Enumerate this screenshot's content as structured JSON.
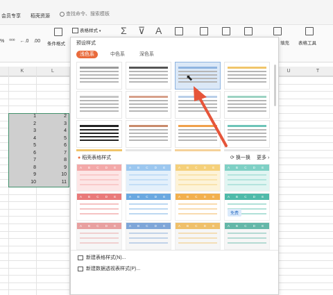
{
  "menubar": {
    "items": [
      "会员专享",
      "稻壳资源"
    ],
    "search_placeholder": "查找命令、搜索模板"
  },
  "ribbon": {
    "table_style_label": "表格样式",
    "conditional_format_label": "条件格式",
    "fill_label": "填充",
    "table_tools_label": "表格工具",
    "format_symbols": [
      "%",
      "⁰⁰⁰",
      "←.0",
      ".00"
    ]
  },
  "sheet": {
    "columns": [
      "K",
      "L",
      "U",
      "T"
    ],
    "col_k_values": [
      "1",
      "2",
      "3",
      "4",
      "5",
      "6",
      "7",
      "8",
      "9",
      "10"
    ],
    "col_l_values": [
      "2",
      "3",
      "4",
      "5",
      "6",
      "7",
      "8",
      "9",
      "10",
      "11"
    ]
  },
  "popup": {
    "preset_label": "预设样式",
    "tabs": [
      "浅色系",
      "中色系",
      "深色系"
    ],
    "docer_label": "稻壳表格样式",
    "refresh_label": "换一换",
    "more_label": "更多",
    "template_header": "A B C D E",
    "free_badge": "免费",
    "new_style_label": "新建表格样式(N)...",
    "new_pivot_label": "新建数据透视表样式(P)..."
  },
  "colors": {
    "accent": "#e96b3c",
    "arrow": "#e6553a",
    "selection_fill": "#cfcfcf",
    "selection_border": "#3f8f6a"
  },
  "thumbs_row1": [
    "#9a9a9a",
    "#555555",
    "#8fb4e0",
    "#f0c56a"
  ],
  "thumbs_row2": [
    "#c5c5c5",
    "#d6a08a",
    "#b9cfe8",
    "#9bd2c2"
  ],
  "thumbs_row3": [
    "#222222",
    "#c98a6a",
    "#f0a04a",
    "#6cc4b8"
  ],
  "templates": [
    {
      "head": "#f3a9a9",
      "body": "#fde6e6"
    },
    {
      "head": "#9cc7ef",
      "body": "#e4f0fb"
    },
    {
      "head": "#f5d07a",
      "body": "#fdf3d8"
    },
    {
      "head": "#7fd0c5",
      "body": "#e1f5f2"
    },
    {
      "head": "#e97a7a",
      "body": "#ffffff"
    },
    {
      "head": "#6aa8e0",
      "body": "#ffffff"
    },
    {
      "head": "#f2b04e",
      "body": "#ffffff"
    },
    {
      "head": "#4fbaa9",
      "body": "#ffffff"
    },
    {
      "head": "#e8a0a0",
      "body": "#f6f6f6"
    },
    {
      "head": "#7fa6d8",
      "body": "#f6f6f6"
    },
    {
      "head": "#efc06a",
      "body": "#f6f6f6"
    },
    {
      "head": "#64b7a8",
      "body": "#f6f6f6"
    }
  ]
}
